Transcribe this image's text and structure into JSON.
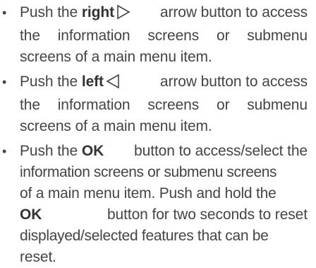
{
  "bullets": [
    {
      "symbol": "•",
      "push": "Push the",
      "keyword": "right",
      "icon": "right-triangle-arrow-icon",
      "line1_after": "arrow button to access",
      "line2": [
        "the",
        "information",
        "screens",
        "or",
        "submenu"
      ],
      "line3": "screens of a main menu item."
    },
    {
      "symbol": "•",
      "push": "Push the",
      "keyword": "left",
      "icon": "left-triangle-arrow-icon",
      "line1_after": "arrow button to access",
      "line2": [
        "the",
        "information",
        "screens",
        "or",
        "submenu"
      ],
      "line3": "screens of a main menu item."
    },
    {
      "symbol": "•",
      "push": "Push the",
      "keyword": "OK",
      "line1_after": "button to access/select the",
      "line2": "information screens or submenu screens",
      "line3": "of a main menu item. Push and hold the",
      "line4_keyword": "OK",
      "line4_after": "button for two seconds to reset",
      "line5": "displayed/selected features that can be",
      "line6": "reset."
    }
  ]
}
